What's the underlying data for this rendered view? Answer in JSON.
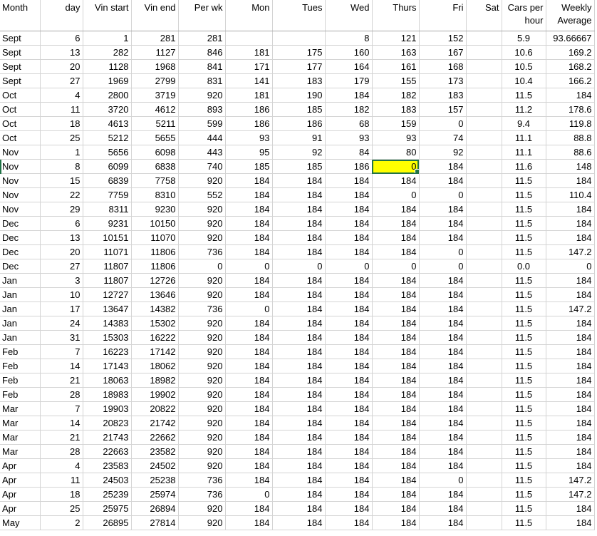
{
  "columns": [
    "Month",
    "day",
    "Vin start",
    "Vin end",
    "Per wk",
    "Mon",
    "Tues",
    "Wed",
    "Thurs",
    "Fri",
    "Sat",
    "Cars per hour",
    "Weekly Average"
  ],
  "rows": [
    [
      "Sept",
      "6",
      "1",
      "281",
      "281",
      "",
      "",
      "8",
      "121",
      "152",
      "",
      "5.9",
      "93.66667"
    ],
    [
      "Sept",
      "13",
      "282",
      "1127",
      "846",
      "181",
      "175",
      "160",
      "163",
      "167",
      "",
      "10.6",
      "169.2"
    ],
    [
      "Sept",
      "20",
      "1128",
      "1968",
      "841",
      "171",
      "177",
      "164",
      "161",
      "168",
      "",
      "10.5",
      "168.2"
    ],
    [
      "Sept",
      "27",
      "1969",
      "2799",
      "831",
      "141",
      "183",
      "179",
      "155",
      "173",
      "",
      "10.4",
      "166.2"
    ],
    [
      "Oct",
      "4",
      "2800",
      "3719",
      "920",
      "181",
      "190",
      "184",
      "182",
      "183",
      "",
      "11.5",
      "184"
    ],
    [
      "Oct",
      "11",
      "3720",
      "4612",
      "893",
      "186",
      "185",
      "182",
      "183",
      "157",
      "",
      "11.2",
      "178.6"
    ],
    [
      "Oct",
      "18",
      "4613",
      "5211",
      "599",
      "186",
      "186",
      "68",
      "159",
      "0",
      "",
      "9.4",
      "119.8"
    ],
    [
      "Oct",
      "25",
      "5212",
      "5655",
      "444",
      "93",
      "91",
      "93",
      "93",
      "74",
      "",
      "11.1",
      "88.8"
    ],
    [
      "Nov",
      "1",
      "5656",
      "6098",
      "443",
      "95",
      "92",
      "84",
      "80",
      "92",
      "",
      "11.1",
      "88.6"
    ],
    [
      "Nov",
      "8",
      "6099",
      "6838",
      "740",
      "185",
      "185",
      "186",
      "0",
      "184",
      "",
      "11.6",
      "148"
    ],
    [
      "Nov",
      "15",
      "6839",
      "7758",
      "920",
      "184",
      "184",
      "184",
      "184",
      "184",
      "",
      "11.5",
      "184"
    ],
    [
      "Nov",
      "22",
      "7759",
      "8310",
      "552",
      "184",
      "184",
      "184",
      "0",
      "0",
      "",
      "11.5",
      "110.4"
    ],
    [
      "Nov",
      "29",
      "8311",
      "9230",
      "920",
      "184",
      "184",
      "184",
      "184",
      "184",
      "",
      "11.5",
      "184"
    ],
    [
      "Dec",
      "6",
      "9231",
      "10150",
      "920",
      "184",
      "184",
      "184",
      "184",
      "184",
      "",
      "11.5",
      "184"
    ],
    [
      "Dec",
      "13",
      "10151",
      "11070",
      "920",
      "184",
      "184",
      "184",
      "184",
      "184",
      "",
      "11.5",
      "184"
    ],
    [
      "Dec",
      "20",
      "11071",
      "11806",
      "736",
      "184",
      "184",
      "184",
      "184",
      "0",
      "",
      "11.5",
      "147.2"
    ],
    [
      "Dec",
      "27",
      "11807",
      "11806",
      "0",
      "0",
      "0",
      "0",
      "0",
      "0",
      "",
      "0.0",
      "0"
    ],
    [
      "Jan",
      "3",
      "11807",
      "12726",
      "920",
      "184",
      "184",
      "184",
      "184",
      "184",
      "",
      "11.5",
      "184"
    ],
    [
      "Jan",
      "10",
      "12727",
      "13646",
      "920",
      "184",
      "184",
      "184",
      "184",
      "184",
      "",
      "11.5",
      "184"
    ],
    [
      "Jan",
      "17",
      "13647",
      "14382",
      "736",
      "0",
      "184",
      "184",
      "184",
      "184",
      "",
      "11.5",
      "147.2"
    ],
    [
      "Jan",
      "24",
      "14383",
      "15302",
      "920",
      "184",
      "184",
      "184",
      "184",
      "184",
      "",
      "11.5",
      "184"
    ],
    [
      "Jan",
      "31",
      "15303",
      "16222",
      "920",
      "184",
      "184",
      "184",
      "184",
      "184",
      "",
      "11.5",
      "184"
    ],
    [
      "Feb",
      "7",
      "16223",
      "17142",
      "920",
      "184",
      "184",
      "184",
      "184",
      "184",
      "",
      "11.5",
      "184"
    ],
    [
      "Feb",
      "14",
      "17143",
      "18062",
      "920",
      "184",
      "184",
      "184",
      "184",
      "184",
      "",
      "11.5",
      "184"
    ],
    [
      "Feb",
      "21",
      "18063",
      "18982",
      "920",
      "184",
      "184",
      "184",
      "184",
      "184",
      "",
      "11.5",
      "184"
    ],
    [
      "Feb",
      "28",
      "18983",
      "19902",
      "920",
      "184",
      "184",
      "184",
      "184",
      "184",
      "",
      "11.5",
      "184"
    ],
    [
      "Mar",
      "7",
      "19903",
      "20822",
      "920",
      "184",
      "184",
      "184",
      "184",
      "184",
      "",
      "11.5",
      "184"
    ],
    [
      "Mar",
      "14",
      "20823",
      "21742",
      "920",
      "184",
      "184",
      "184",
      "184",
      "184",
      "",
      "11.5",
      "184"
    ],
    [
      "Mar",
      "21",
      "21743",
      "22662",
      "920",
      "184",
      "184",
      "184",
      "184",
      "184",
      "",
      "11.5",
      "184"
    ],
    [
      "Mar",
      "28",
      "22663",
      "23582",
      "920",
      "184",
      "184",
      "184",
      "184",
      "184",
      "",
      "11.5",
      "184"
    ],
    [
      "Apr",
      "4",
      "23583",
      "24502",
      "920",
      "184",
      "184",
      "184",
      "184",
      "184",
      "",
      "11.5",
      "184"
    ],
    [
      "Apr",
      "11",
      "24503",
      "25238",
      "736",
      "184",
      "184",
      "184",
      "184",
      "0",
      "",
      "11.5",
      "147.2"
    ],
    [
      "Apr",
      "18",
      "25239",
      "25974",
      "736",
      "0",
      "184",
      "184",
      "184",
      "184",
      "",
      "11.5",
      "147.2"
    ],
    [
      "Apr",
      "25",
      "25975",
      "26894",
      "920",
      "184",
      "184",
      "184",
      "184",
      "184",
      "",
      "11.5",
      "184"
    ],
    [
      "May",
      "2",
      "26895",
      "27814",
      "920",
      "184",
      "184",
      "184",
      "184",
      "184",
      "",
      "11.5",
      "184"
    ]
  ],
  "highlight": {
    "row": 9,
    "col": 8,
    "color": "#ffff00"
  },
  "colors": {
    "grid": "#d4d4d4",
    "selection": "#217346",
    "highlight": "#ffff00"
  }
}
